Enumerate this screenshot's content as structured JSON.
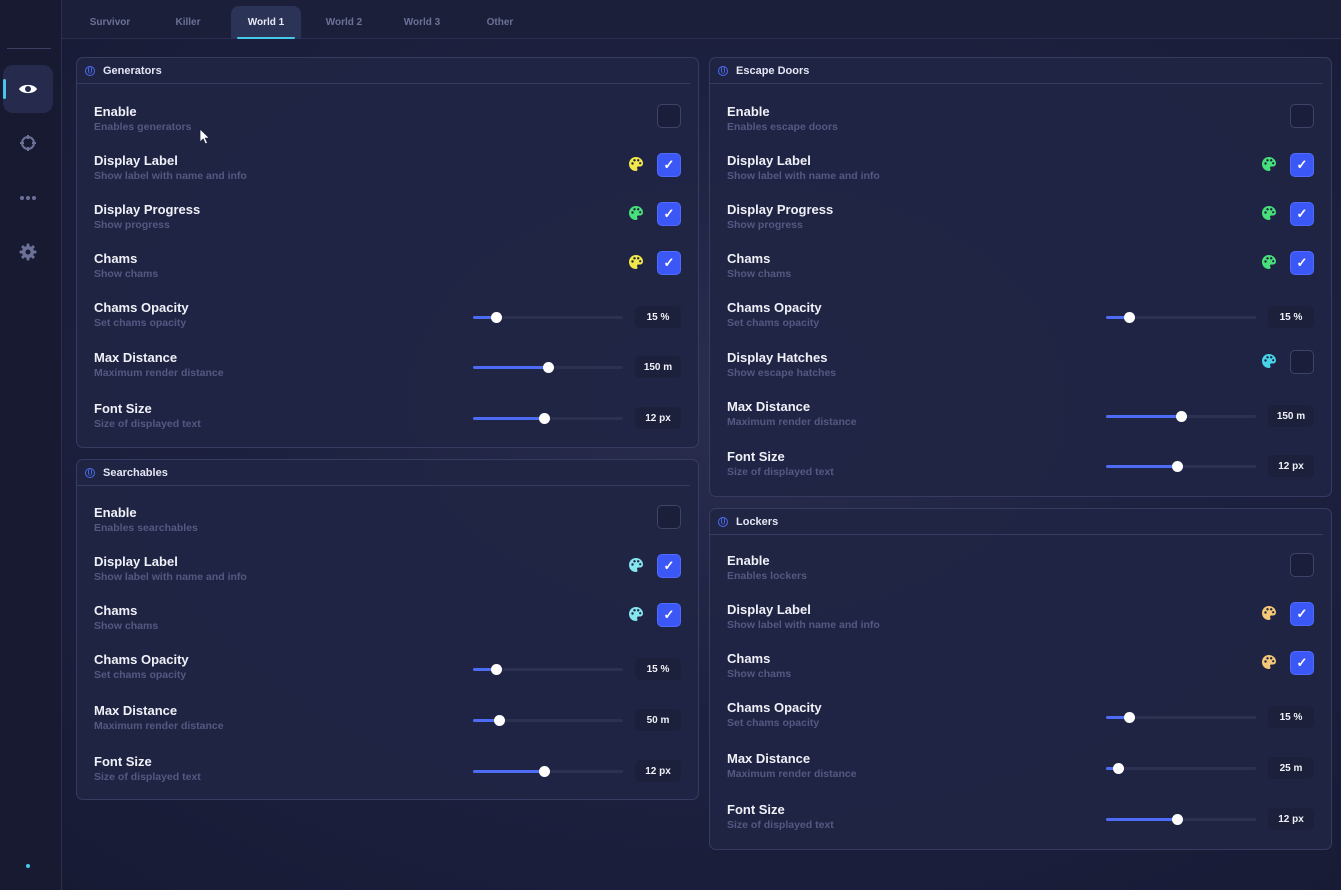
{
  "colors": {
    "accent": "#3b57f5",
    "cyan_indicator": "#47c8e8",
    "palette_yellow": "#f2e84b",
    "palette_green": "#47e07a",
    "palette_cyan": "#86e6ef",
    "palette_orange": "#f4c876"
  },
  "sidebar": {
    "items": [
      {
        "icon": "eye-icon",
        "active": true
      },
      {
        "icon": "crosshair-icon",
        "active": false
      },
      {
        "icon": "more-icon",
        "active": false
      },
      {
        "icon": "gear-icon",
        "active": false
      }
    ]
  },
  "tabs": [
    {
      "label": "Survivor",
      "active": false
    },
    {
      "label": "Killer",
      "active": false
    },
    {
      "label": "World 1",
      "active": true
    },
    {
      "label": "World 2",
      "active": false
    },
    {
      "label": "World 3",
      "active": false
    },
    {
      "label": "Other",
      "active": false
    }
  ],
  "panels": {
    "generators": {
      "title": "Generators",
      "enable": {
        "title": "Enable",
        "desc": "Enables generators",
        "checked": false
      },
      "display_label": {
        "title": "Display Label",
        "desc": "Show label with name and info",
        "checked": true,
        "color": "yellow"
      },
      "display_progress": {
        "title": "Display Progress",
        "desc": "Show progress",
        "checked": true,
        "color": "green"
      },
      "chams": {
        "title": "Chams",
        "desc": "Show chams",
        "checked": true,
        "color": "yellow"
      },
      "chams_opacity": {
        "title": "Chams Opacity",
        "desc": "Set chams opacity",
        "value": "15 %",
        "fraction": 0.15
      },
      "max_distance": {
        "title": "Max Distance",
        "desc": "Maximum render distance",
        "value": "150 m",
        "fraction": 0.5
      },
      "font_size": {
        "title": "Font Size",
        "desc": "Size of displayed text",
        "value": "12 px",
        "fraction": 0.47
      }
    },
    "searchables": {
      "title": "Searchables",
      "enable": {
        "title": "Enable",
        "desc": "Enables searchables",
        "checked": false
      },
      "display_label": {
        "title": "Display Label",
        "desc": "Show label with name and info",
        "checked": true,
        "color": "cyan"
      },
      "chams": {
        "title": "Chams",
        "desc": "Show chams",
        "checked": true,
        "color": "cyan"
      },
      "chams_opacity": {
        "title": "Chams Opacity",
        "desc": "Set chams opacity",
        "value": "15 %",
        "fraction": 0.15
      },
      "max_distance": {
        "title": "Max Distance",
        "desc": "Maximum render distance",
        "value": "50 m",
        "fraction": 0.17
      },
      "font_size": {
        "title": "Font Size",
        "desc": "Size of displayed text",
        "value": "12 px",
        "fraction": 0.47
      }
    },
    "escape_doors": {
      "title": "Escape Doors",
      "enable": {
        "title": "Enable",
        "desc": "Enables escape doors",
        "checked": false
      },
      "display_label": {
        "title": "Display Label",
        "desc": "Show label with name and info",
        "checked": true,
        "color": "green"
      },
      "display_progress": {
        "title": "Display Progress",
        "desc": "Show progress",
        "checked": true,
        "color": "green"
      },
      "chams": {
        "title": "Chams",
        "desc": "Show chams",
        "checked": true,
        "color": "green"
      },
      "chams_opacity": {
        "title": "Chams Opacity",
        "desc": "Set chams opacity",
        "value": "15 %",
        "fraction": 0.15
      },
      "display_hatches": {
        "title": "Display Hatches",
        "desc": "Show escape hatches",
        "checked": false,
        "color": "cyan"
      },
      "max_distance": {
        "title": "Max Distance",
        "desc": "Maximum render distance",
        "value": "150 m",
        "fraction": 0.5
      },
      "font_size": {
        "title": "Font Size",
        "desc": "Size of displayed text",
        "value": "12 px",
        "fraction": 0.47
      }
    },
    "lockers": {
      "title": "Lockers",
      "enable": {
        "title": "Enable",
        "desc": "Enables lockers",
        "checked": false
      },
      "display_label": {
        "title": "Display Label",
        "desc": "Show label with name and info",
        "checked": true,
        "color": "orange"
      },
      "chams": {
        "title": "Chams",
        "desc": "Show chams",
        "checked": true,
        "color": "orange"
      },
      "chams_opacity": {
        "title": "Chams Opacity",
        "desc": "Set chams opacity",
        "value": "15 %",
        "fraction": 0.15
      },
      "max_distance": {
        "title": "Max Distance",
        "desc": "Maximum render distance",
        "value": "25 m",
        "fraction": 0.08
      },
      "font_size": {
        "title": "Font Size",
        "desc": "Size of displayed text",
        "value": "12 px",
        "fraction": 0.47
      }
    }
  }
}
